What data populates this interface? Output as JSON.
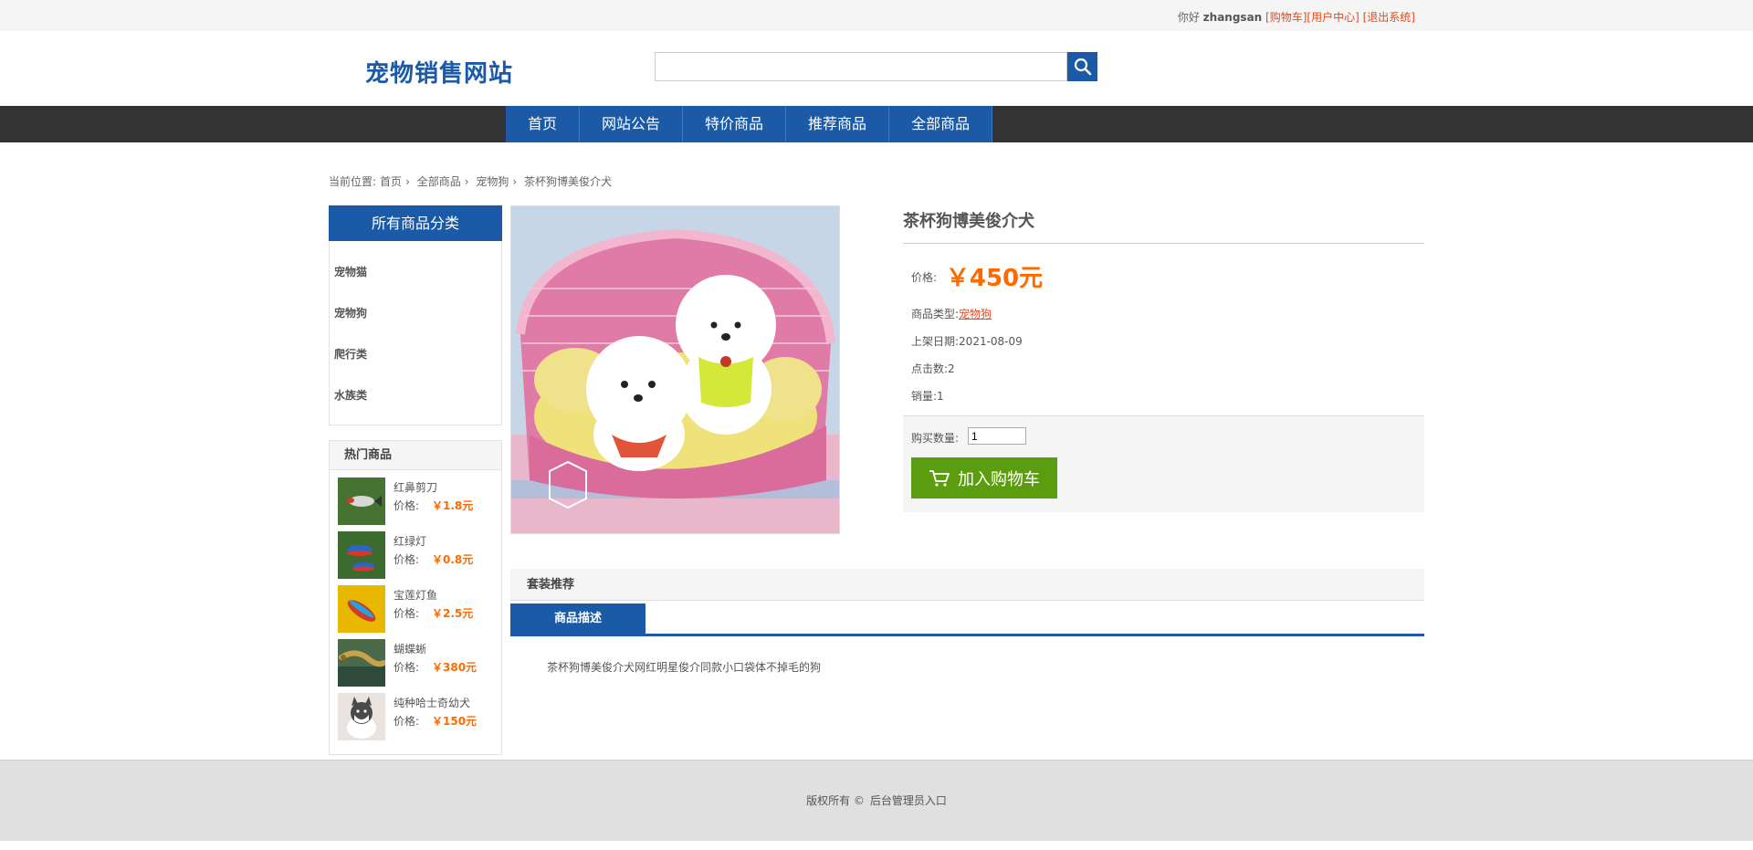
{
  "topbar": {
    "greeting": "你好",
    "username": "zhangsan",
    "cart_link": "[购物车]",
    "user_center_link": "[用户中心]",
    "logout_link": "[退出系统]"
  },
  "header": {
    "logo": "宠物销售网站",
    "search_value": ""
  },
  "nav": {
    "items": [
      "首页",
      "网站公告",
      "特价商品",
      "推荐商品",
      "全部商品"
    ]
  },
  "breadcrumb": {
    "prefix": "当前位置:",
    "items": [
      "首页",
      "全部商品",
      "宠物狗",
      "茶杯狗博美俊介犬"
    ]
  },
  "sidebar": {
    "categories_title": "所有商品分类",
    "categories": [
      "宠物猫",
      "宠物狗",
      "爬行类",
      "水族类"
    ],
    "hot_title": "热门商品",
    "price_label": "价格:",
    "hot_items": [
      {
        "name": "红鼻剪刀",
        "price": "￥1.8元"
      },
      {
        "name": "红绿灯",
        "price": "￥0.8元"
      },
      {
        "name": "宝莲灯鱼",
        "price": "￥2.5元"
      },
      {
        "name": "蝴蝶蜥",
        "price": "￥380元"
      },
      {
        "name": "纯种哈士奇幼犬",
        "price": "￥150元"
      }
    ]
  },
  "product": {
    "title": "茶杯狗博美俊介犬",
    "price_label": "价格:",
    "price": "￥450元",
    "type_label": "商品类型:",
    "type": "宠物狗",
    "date_label": "上架日期:",
    "date": "2021-08-09",
    "clicks_label": "点击数:",
    "clicks": "2",
    "sales_label": "销量:",
    "sales": "1",
    "qty_label": "购买数量:",
    "qty": "1",
    "add_cart": "加入购物车"
  },
  "tabs": {
    "bundle": "套装推荐",
    "description_tab": "商品描述",
    "description": "茶杯狗博美俊介犬网红明星俊介同款小口袋体不掉毛的狗"
  },
  "footer": {
    "copyright": "版权所有 ©",
    "admin_link": "后台管理员入口"
  },
  "colors": {
    "brand_blue": "#1a5aa7",
    "price_orange": "#ff6a00",
    "cart_green": "#5c9c0f",
    "nav_dark": "#333333"
  }
}
